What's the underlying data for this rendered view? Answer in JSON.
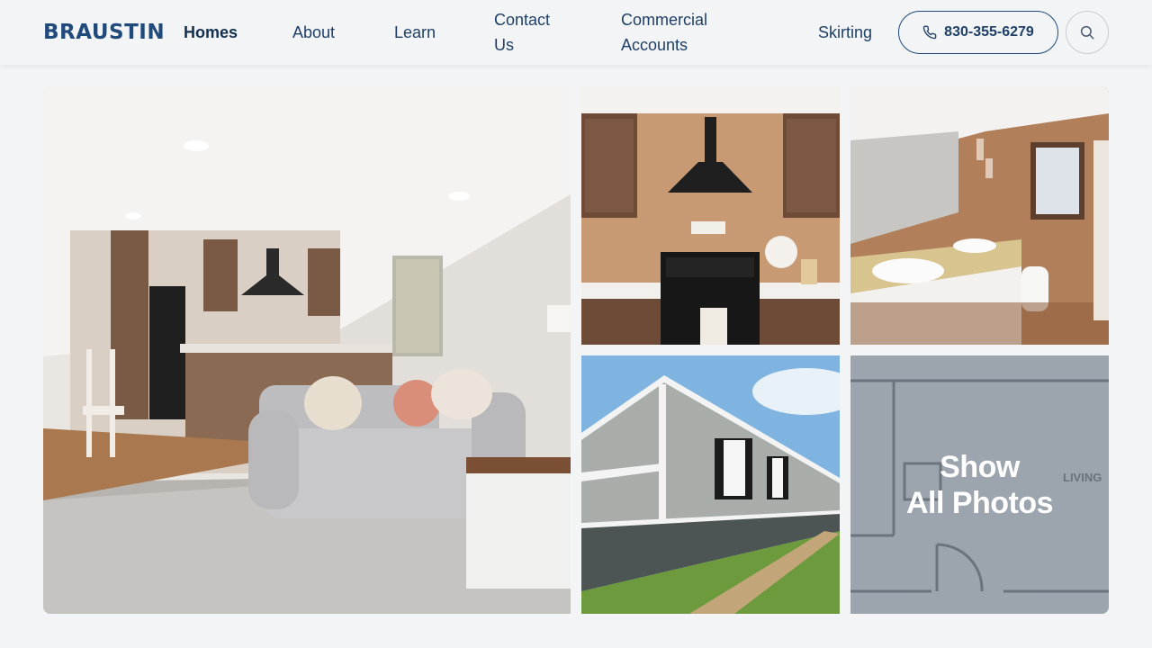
{
  "brand": {
    "logo_text": "BRAUSTIN",
    "accent_color": "#1f4a7a"
  },
  "nav": {
    "items": [
      {
        "label": "Homes",
        "active": true
      },
      {
        "label": "About",
        "active": false
      },
      {
        "label": "Learn",
        "active": false
      },
      {
        "label": "Contact Us",
        "line1": "Contact",
        "line2": "Us",
        "active": false
      },
      {
        "label": "Commercial Accounts",
        "line1": "Commercial",
        "line2": "Accounts",
        "active": false
      },
      {
        "label": "Skirting",
        "active": false
      }
    ],
    "phone": {
      "icon": "phone-icon",
      "number": "830-355-6279"
    },
    "search": {
      "icon": "search-icon"
    }
  },
  "gallery": {
    "photos": [
      {
        "name": "living-room-photo"
      },
      {
        "name": "kitchen-photo"
      },
      {
        "name": "bathroom-photo"
      },
      {
        "name": "exterior-photo"
      },
      {
        "name": "floorplan-photo"
      }
    ],
    "show_all": {
      "line1": "Show",
      "line2": "All Photos"
    },
    "floorplan_label": "LIVING"
  }
}
